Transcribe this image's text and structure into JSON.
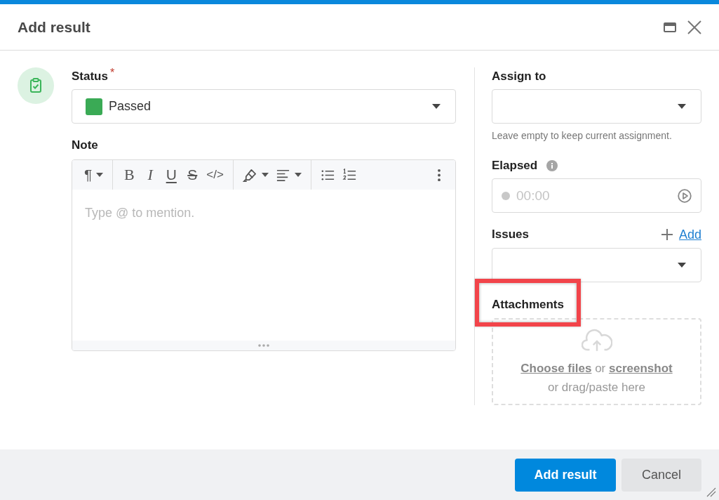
{
  "dialog": {
    "title": "Add result"
  },
  "status": {
    "label": "Status",
    "required_mark": "*",
    "value": "Passed",
    "color": "#3aaa55"
  },
  "note": {
    "label": "Note",
    "toolbar": [
      [
        {
          "kind": "paragraph",
          "glyph": "¶",
          "menu": true
        }
      ],
      [
        {
          "kind": "bold",
          "glyph": "B",
          "menu": false
        },
        {
          "kind": "italic",
          "glyph": "I",
          "menu": false
        },
        {
          "kind": "underline",
          "glyph": "U",
          "menu": false
        },
        {
          "kind": "strike",
          "glyph": "S",
          "menu": false
        },
        {
          "kind": "code",
          "glyph": "</>",
          "menu": false
        }
      ],
      [
        {
          "kind": "highlight",
          "menu": true
        },
        {
          "kind": "align",
          "menu": true
        }
      ],
      [
        {
          "kind": "bullets",
          "menu": false
        },
        {
          "kind": "numbers",
          "menu": false
        },
        {
          "kind": "more",
          "menu": false
        }
      ]
    ],
    "placeholder": "Type @ to mention."
  },
  "assign_to": {
    "label": "Assign to",
    "hint": "Leave empty to keep current assignment."
  },
  "elapsed": {
    "label": "Elapsed",
    "placeholder": "00:00"
  },
  "issues": {
    "label": "Issues",
    "add_link": "Add"
  },
  "attachments": {
    "label": "Attachments",
    "highlighted": true,
    "choose_link": "Choose files",
    "between": "or",
    "screenshot_link": "screenshot",
    "after": "or drag/paste here"
  },
  "buttons": [
    {
      "label": "Add result",
      "kind": "primary"
    },
    {
      "label": "Cancel",
      "kind": "secondary"
    }
  ]
}
